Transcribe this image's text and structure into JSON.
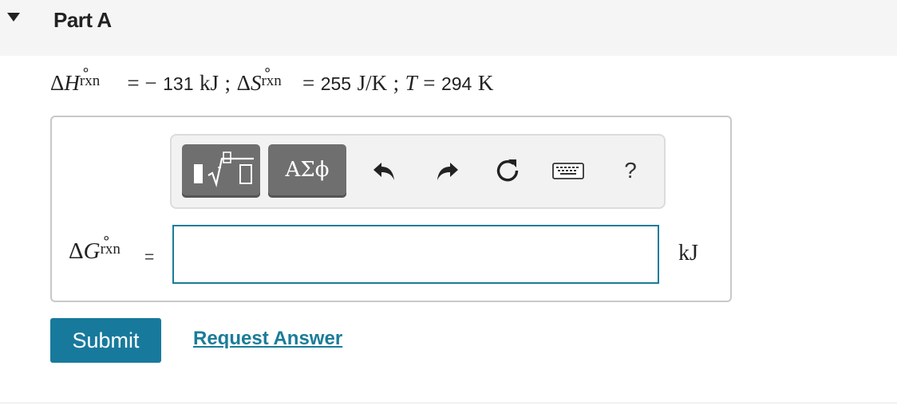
{
  "header": {
    "part_title": "Part A"
  },
  "given": {
    "dh_symbol": "Δ",
    "dh_var": "H",
    "dh_sup": "∘",
    "dh_sub": "rxn",
    "dh_eq": "= −",
    "dh_value": "131",
    "dh_unit": "kJ",
    "sep1": ";",
    "ds_symbol": "Δ",
    "ds_var": "S",
    "ds_sup": "∘",
    "ds_sub": "rxn",
    "ds_eq": "=",
    "ds_value": "255",
    "ds_unit": "J/K",
    "sep2": ";",
    "t_var": "T",
    "t_eq": "=",
    "t_value": "294",
    "t_unit": "K"
  },
  "toolbar": {
    "templates_icon": "templates-sqrt-icon",
    "greek_label": "ΑΣϕ",
    "undo_icon": "undo-arrow-icon",
    "redo_icon": "redo-arrow-icon",
    "reset_icon": "reset-circular-arrow-icon",
    "keyboard_icon": "keyboard-icon",
    "help_label": "?"
  },
  "answer": {
    "label_symbol": "Δ",
    "label_var": "G",
    "label_sup": "∘",
    "label_sub": "rxn",
    "equals": "=",
    "input_value": "",
    "units": "kJ"
  },
  "actions": {
    "submit_label": "Submit",
    "request_answer_label": "Request Answer"
  },
  "colors": {
    "accent": "#177a9c",
    "input_border": "#1a7c98",
    "toolbar_button": "#6f6f6f",
    "header_bg": "#f5f5f5"
  }
}
